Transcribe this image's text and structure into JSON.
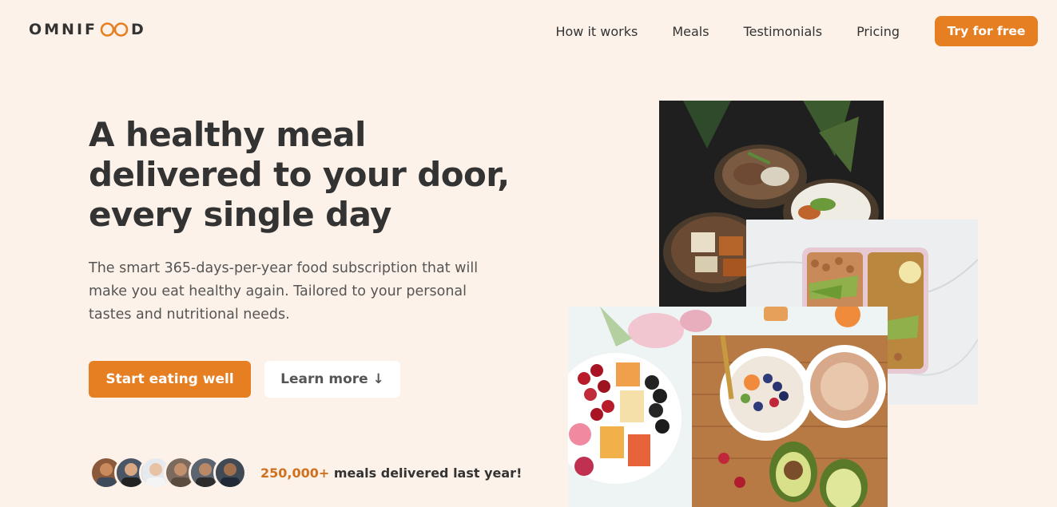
{
  "brand": {
    "name_prefix": "OMNIF",
    "name_suffix": "D"
  },
  "nav": {
    "items": [
      {
        "label": "How it works"
      },
      {
        "label": "Meals"
      },
      {
        "label": "Testimonials"
      },
      {
        "label": "Pricing"
      }
    ],
    "cta_label": "Try for free"
  },
  "hero": {
    "title": "A healthy meal delivered to your door, every single day",
    "description": "The smart 365-days-per-year food subscription that will make you eat healthy again. Tailored to your personal tastes and nutritional needs.",
    "primary_button": "Start eating well",
    "secondary_button": "Learn more ↓"
  },
  "delivered": {
    "count": "250,000+",
    "text": " meals delivered last year!"
  },
  "colors": {
    "accent": "#e67e22",
    "background": "#fdf2e9",
    "text": "#333333"
  }
}
